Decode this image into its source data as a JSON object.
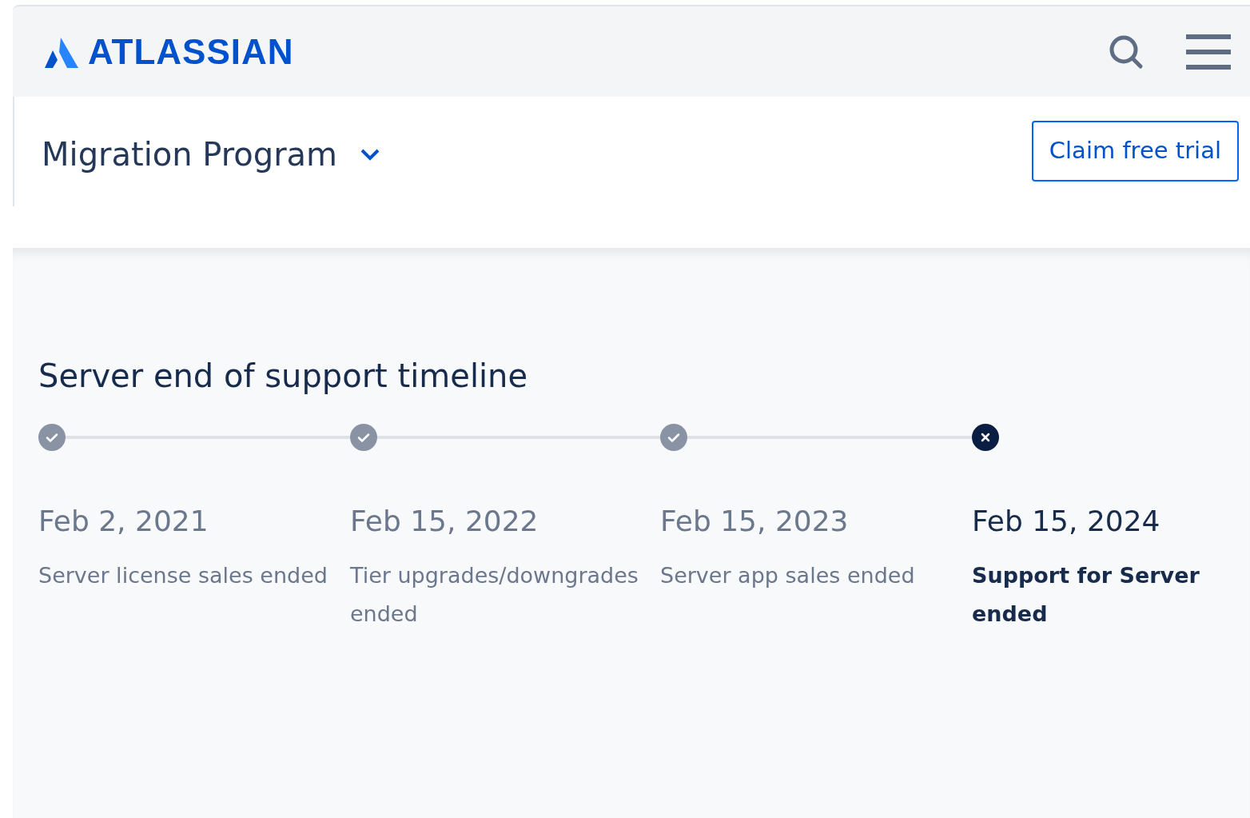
{
  "header": {
    "logo": "ATLASSIAN"
  },
  "subnav": {
    "title": "Migration Program",
    "button": "Claim free trial"
  },
  "timeline": {
    "title": "Server end of support timeline",
    "milestones": [
      {
        "date": "Feb 2, 2021",
        "description": "Server license sales ended",
        "kind": "past"
      },
      {
        "date": "Feb 15, 2022",
        "description": "Tier upgrades/downgrades ended",
        "kind": "past"
      },
      {
        "date": "Feb 15, 2023",
        "description": "Server app sales ended",
        "kind": "past"
      },
      {
        "date": "Feb 15, 2024",
        "description": "Support for Server ended",
        "kind": "current"
      }
    ]
  }
}
